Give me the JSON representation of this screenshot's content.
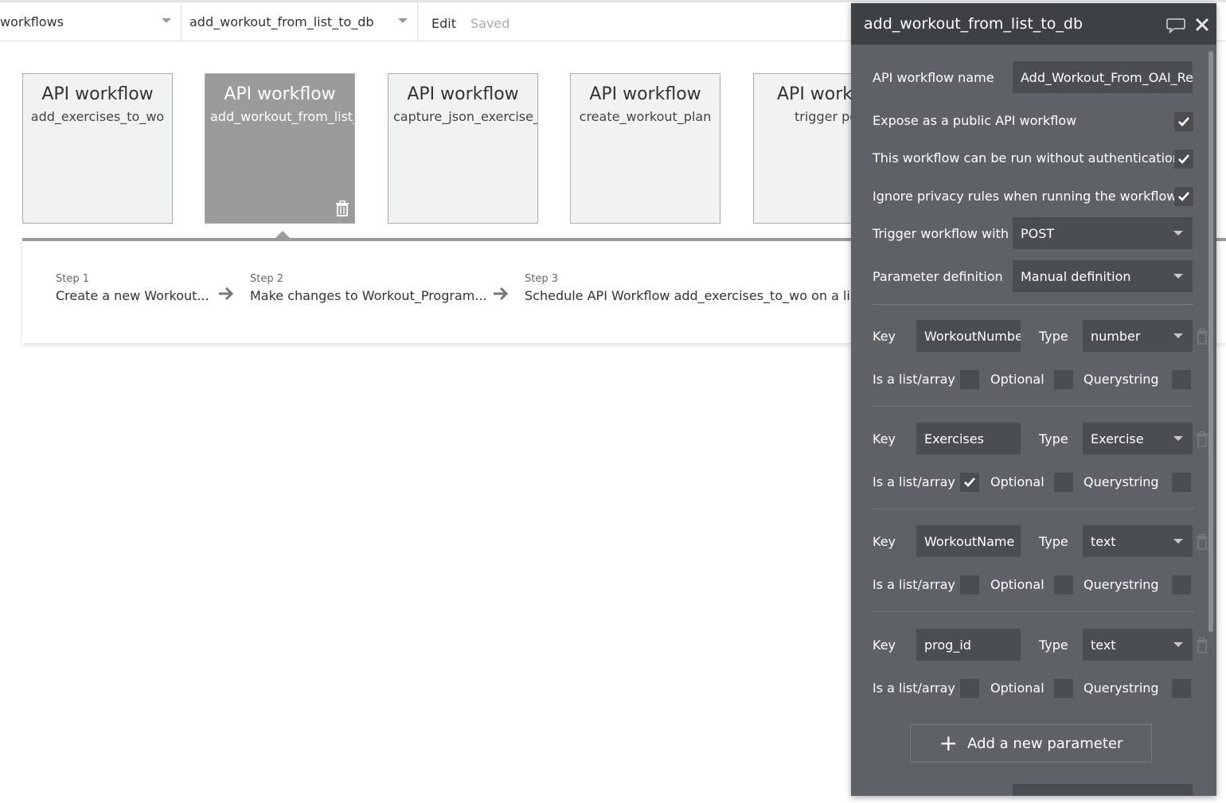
{
  "topbar": {
    "page_dropdown": "workflows",
    "workflow_dropdown": "add_workout_from_list_to_db",
    "edit_label": "Edit",
    "status": "Saved"
  },
  "cards": [
    {
      "title": "API workflow",
      "name": "add_exercises_to_wo",
      "active": false
    },
    {
      "title": "API workflow",
      "name": "add_workout_from_list_",
      "active": true
    },
    {
      "title": "API workflow",
      "name": "capture_json_exercise_d",
      "active": false
    },
    {
      "title": "API workflow",
      "name": "create_workout_plan",
      "active": false
    },
    {
      "title": "API workf",
      "name": "trigger po",
      "active": false
    }
  ],
  "steps": [
    {
      "label": "Step 1",
      "name": "Create a new Workout..."
    },
    {
      "label": "Step 2",
      "name": "Make changes to Workout_Program..."
    },
    {
      "label": "Step 3",
      "name": "Schedule API Workflow add_exercises_to_wo on a list"
    }
  ],
  "panel": {
    "title": "add_workout_from_list_to_db",
    "name_label": "API workflow name",
    "name_value": "Add_Workout_From_OAI_Res",
    "expose_label": "Expose as a public API workflow",
    "expose_checked": true,
    "noauth_label": "This workflow can be run without authentication",
    "noauth_checked": true,
    "privacy_label": "Ignore privacy rules when running the workflow",
    "privacy_checked": true,
    "trigger_label": "Trigger workflow with",
    "trigger_value": "POST",
    "paramdef_label": "Parameter definition",
    "paramdef_value": "Manual definition",
    "key_label": "Key",
    "type_label": "Type",
    "list_label": "Is a list/array",
    "optional_label": "Optional",
    "querystring_label": "Querystring",
    "params": [
      {
        "key": "WorkoutNumbe",
        "type": "number",
        "is_list": false,
        "optional": false,
        "querystring": false
      },
      {
        "key": "Exercises",
        "type": "Exercise",
        "is_list": true,
        "optional": false,
        "querystring": false
      },
      {
        "key": "WorkoutName",
        "type": "text",
        "is_list": false,
        "optional": false,
        "querystring": false
      },
      {
        "key": "prog_id",
        "type": "text",
        "is_list": false,
        "optional": false,
        "querystring": false
      }
    ],
    "add_param_label": "Add a new parameter"
  },
  "colors": {
    "panel_bg": "#5e6266",
    "panel_header": "#3e4144",
    "field_bg": "#4b4e51",
    "active_card": "#9b9b9b"
  }
}
